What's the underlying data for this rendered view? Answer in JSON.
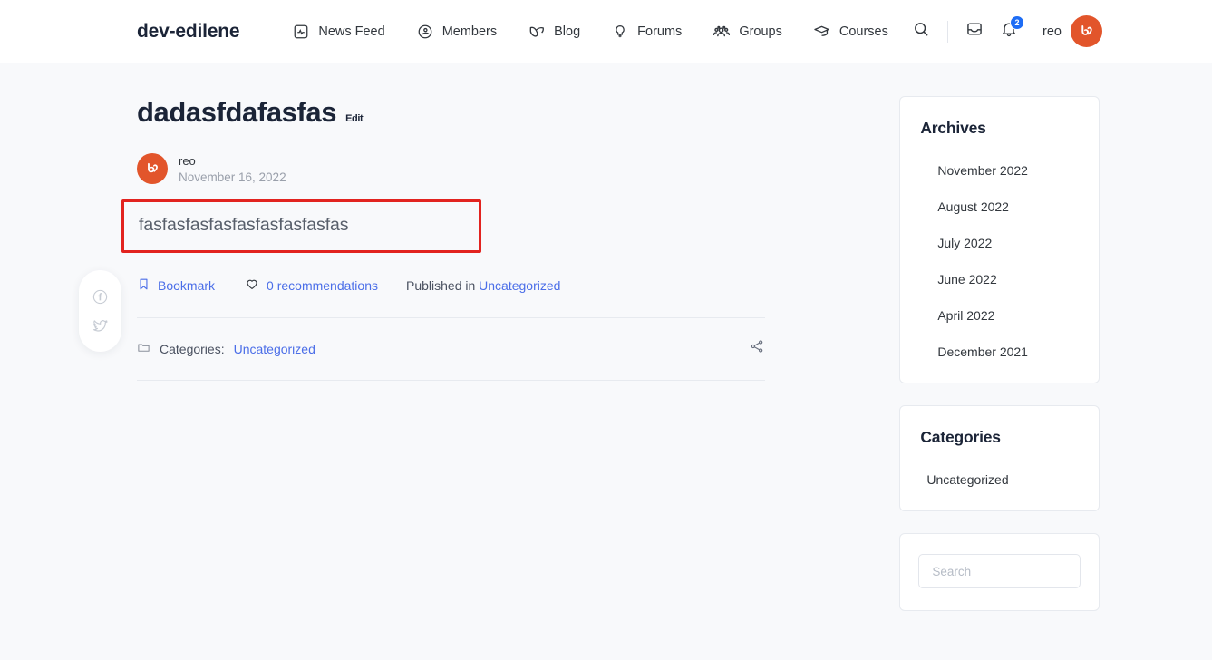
{
  "header": {
    "brand": "dev-edilene",
    "nav": [
      {
        "label": "News Feed",
        "icon": "news-feed-icon"
      },
      {
        "label": "Members",
        "icon": "members-icon"
      },
      {
        "label": "Blog",
        "icon": "blog-icon"
      },
      {
        "label": "Forums",
        "icon": "forums-icon"
      },
      {
        "label": "Groups",
        "icon": "groups-icon"
      },
      {
        "label": "Courses",
        "icon": "courses-icon"
      }
    ],
    "search_icon": "search-icon",
    "messages_icon": "messages-icon",
    "notifications_icon": "bell-icon",
    "notification_count": "2",
    "user_name": "reo",
    "avatar_alt": "reo"
  },
  "post": {
    "title": "dadasfdafasfas",
    "edit_label": "Edit",
    "author": "reo",
    "date": "November 16, 2022",
    "body": "fasfasfasfasfasfasfasfasfas",
    "bookmark_label": "Bookmark",
    "recommendations_label": "0 recommendations",
    "published_prefix": "Published in",
    "published_category": "Uncategorized",
    "categories_label": "Categories:",
    "categories_value": "Uncategorized",
    "highlight_color": "#e2231f",
    "link_color": "#4b6ee8"
  },
  "share_rail": {
    "facebook": "facebook-icon",
    "twitter": "twitter-icon"
  },
  "sidebar": {
    "archives": {
      "title": "Archives",
      "items": [
        "November 2022",
        "August 2022",
        "July 2022",
        "June 2022",
        "April 2022",
        "December 2021"
      ]
    },
    "categories": {
      "title": "Categories",
      "items": [
        "Uncategorized"
      ]
    },
    "search": {
      "placeholder": "Search",
      "value": ""
    }
  }
}
